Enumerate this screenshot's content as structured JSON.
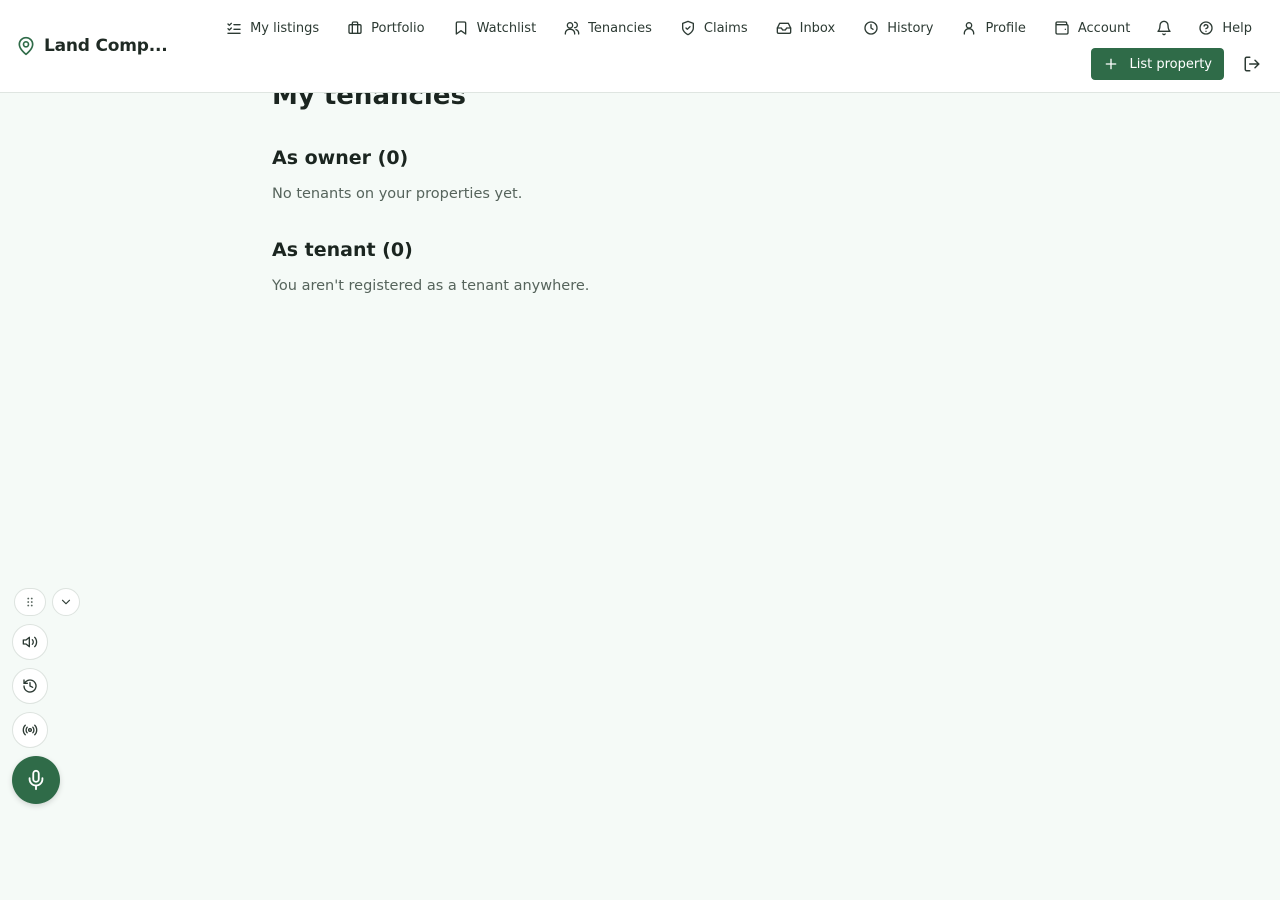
{
  "app": {
    "brand_name": "Land Comp...",
    "accent_color": "#2f6b48",
    "background_color": "#f5faf7"
  },
  "nav": {
    "items": [
      {
        "label": "My listings",
        "icon": "list-check-icon"
      },
      {
        "label": "Portfolio",
        "icon": "briefcase-icon"
      },
      {
        "label": "Watchlist",
        "icon": "bookmark-icon"
      },
      {
        "label": "Tenancies",
        "icon": "users-icon"
      },
      {
        "label": "Claims",
        "icon": "shield-check-icon"
      },
      {
        "label": "Inbox",
        "icon": "inbox-icon"
      },
      {
        "label": "History",
        "icon": "clock-icon"
      },
      {
        "label": "Profile",
        "icon": "user-icon"
      },
      {
        "label": "Account",
        "icon": "wallet-icon"
      }
    ],
    "bell_icon": "bell-icon",
    "help_label": "Help"
  },
  "actions": {
    "list_property_label": "List property"
  },
  "page": {
    "title": "My tenancies",
    "owner_section": {
      "title": "As owner (0)",
      "empty_text": "No tenants on your properties yet."
    },
    "tenant_section": {
      "title": "As tenant (0)",
      "empty_text": "You aren't registered as a tenant anywhere."
    }
  },
  "voice_toolbar": {
    "drag_icon": "grip-icon",
    "collapse_icon": "chevron-down-icon",
    "speak_icon": "speaker-icon",
    "history_icon": "history-icon",
    "broadcast_icon": "broadcast-icon",
    "mic_icon": "microphone-icon"
  }
}
